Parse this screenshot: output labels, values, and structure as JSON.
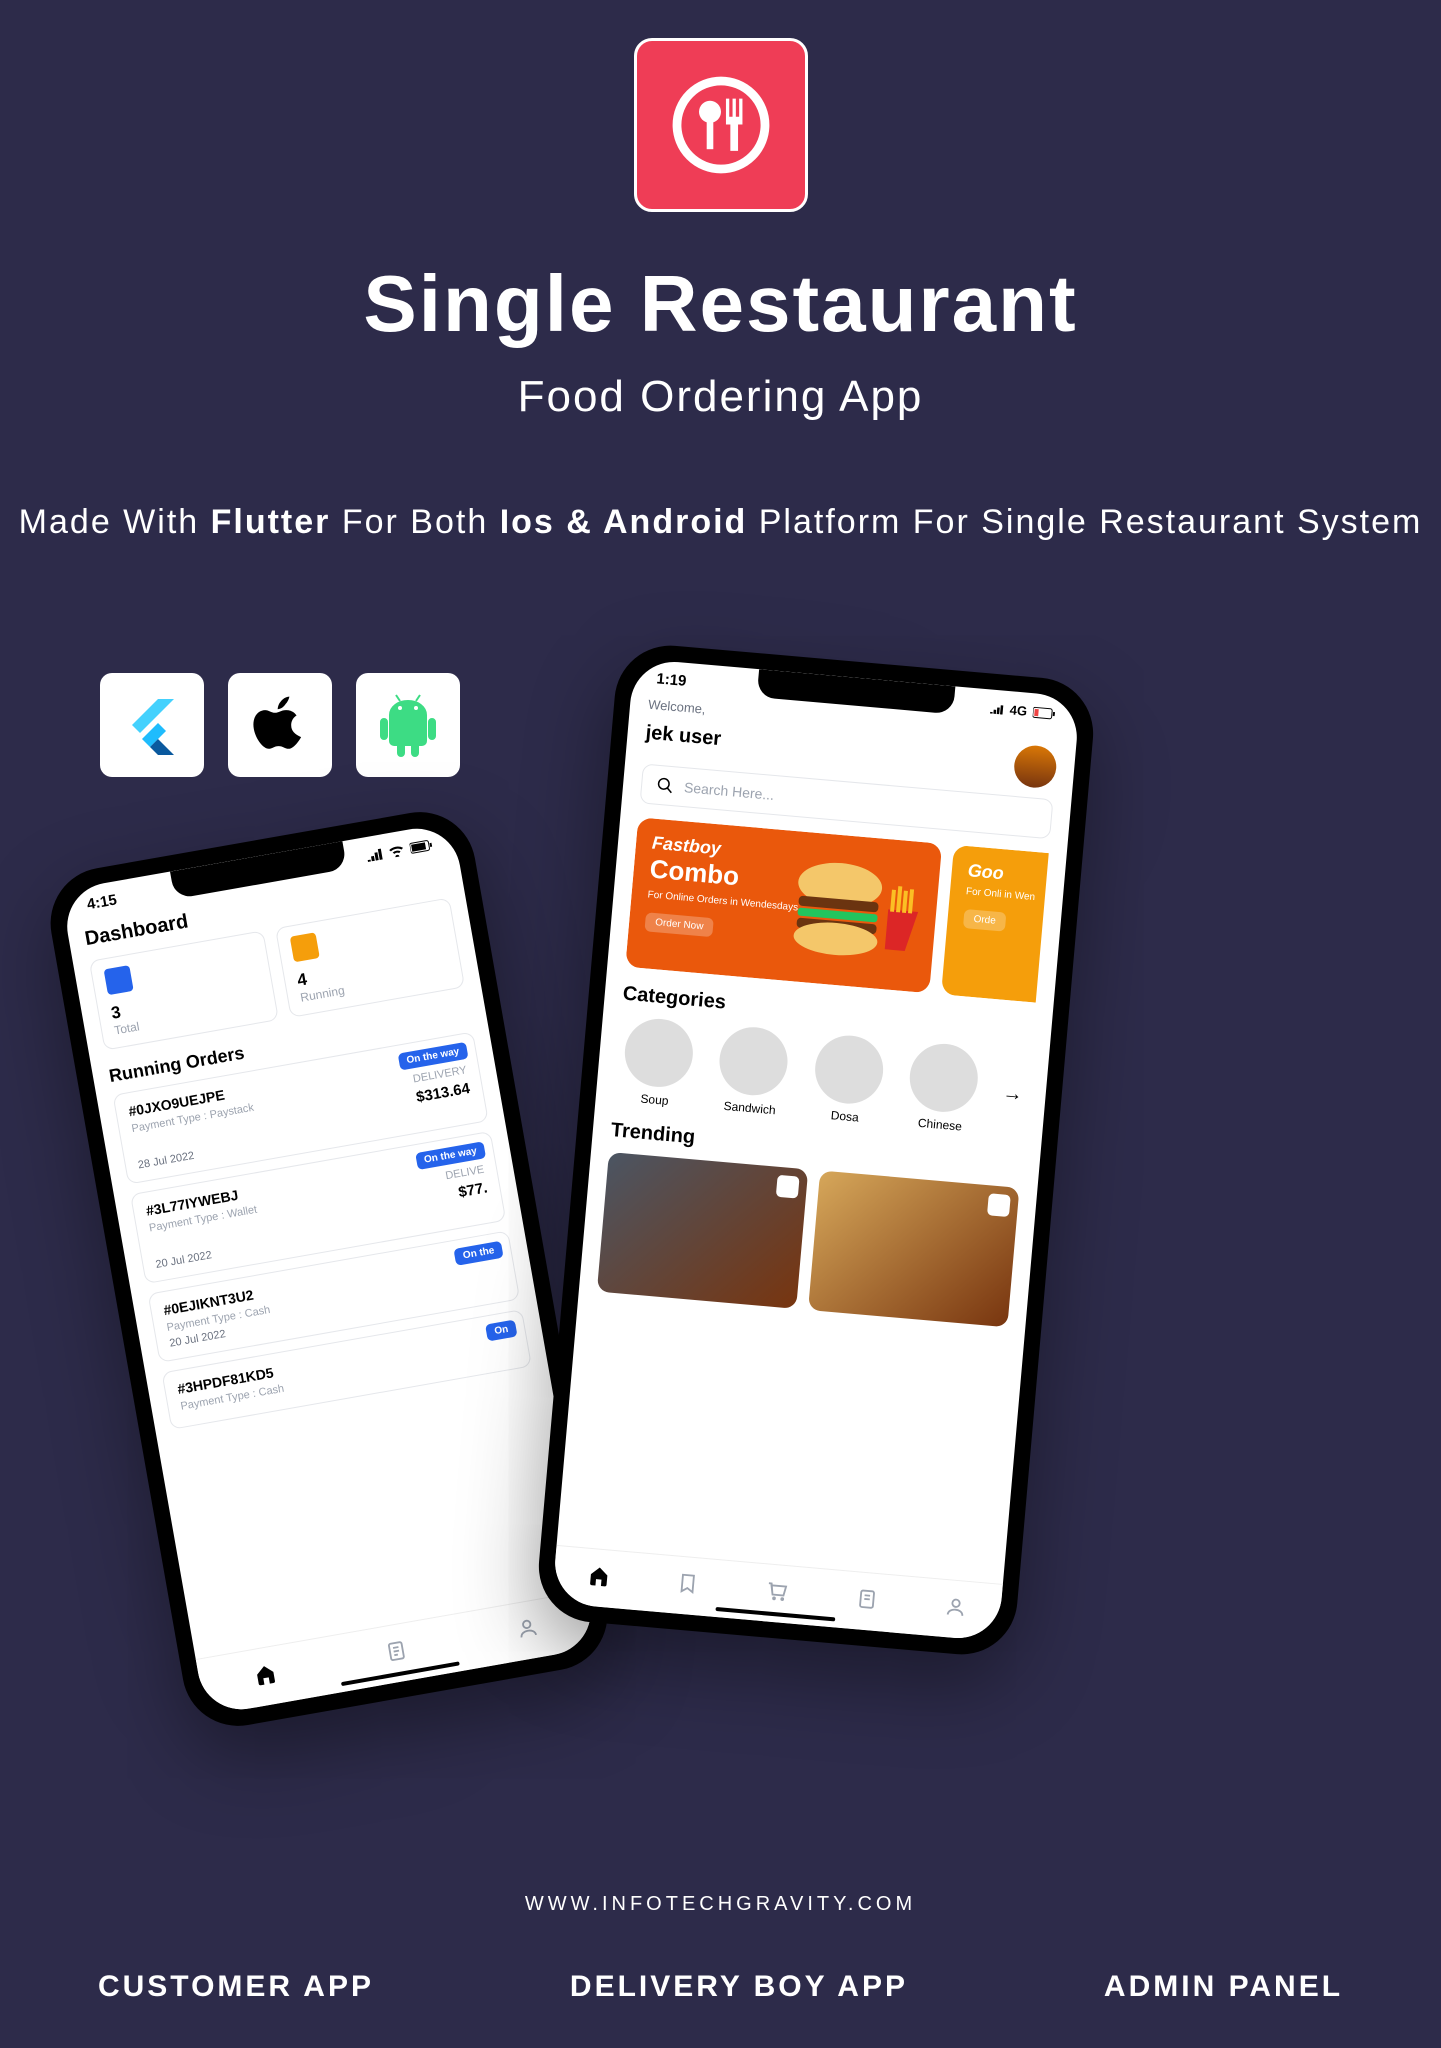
{
  "header": {
    "title": "Single Restaurant",
    "subtitle": "Food Ordering App",
    "desc_pre": "Made With ",
    "desc_b1": "Flutter",
    "desc_mid": " For Both ",
    "desc_b2": "Ios & Android",
    "desc_post": " Platform For Single Restaurant System"
  },
  "phone1": {
    "time": "4:15",
    "title": "Dashboard",
    "stat1_num": "3",
    "stat1_lbl": "Total",
    "stat2_num": "4",
    "stat2_lbl": "Running",
    "section": "Running Orders",
    "orders": [
      {
        "id": "#0JXO9UEJPE",
        "status": "On the way",
        "pay": "Payment Type : Paystack",
        "type": "DELIVERY",
        "price": "$313.64",
        "date": "28 Jul 2022"
      },
      {
        "id": "#3L77IYWEBJ",
        "status": "On the way",
        "pay": "Payment Type : Wallet",
        "type": "DELIVE",
        "price": "$77.",
        "date": "20 Jul 2022"
      },
      {
        "id": "#0EJIKNT3U2",
        "status": "On the",
        "pay": "Payment Type : Cash",
        "type": "",
        "price": "",
        "date": "20 Jul 2022"
      },
      {
        "id": "#3HPDF81KD5",
        "status": "On",
        "pay": "Payment Type : Cash",
        "type": "",
        "price": "",
        "date": ""
      }
    ]
  },
  "phone2": {
    "time": "1:19",
    "signal": "4G",
    "welcome": "Welcome,",
    "user": "jek user",
    "search_placeholder": "Search Here...",
    "banner1": {
      "brand": "Fastboy",
      "big": "Combo",
      "small": "For Online Orders in Wendesdays.",
      "btn": "Order Now"
    },
    "banner2": {
      "brand": "Goo",
      "small": "For Onli in Wen",
      "btn": "Orde"
    },
    "cat_title": "Categories",
    "categories": [
      "Soup",
      "Sandwich",
      "Dosa",
      "Chinese"
    ],
    "trend_title": "Trending"
  },
  "footer": {
    "url": "WWW.INFOTECHGRAVITY.COM",
    "links": [
      "CUSTOMER APP",
      "DELIVERY BOY APP",
      "ADMIN PANEL"
    ]
  }
}
